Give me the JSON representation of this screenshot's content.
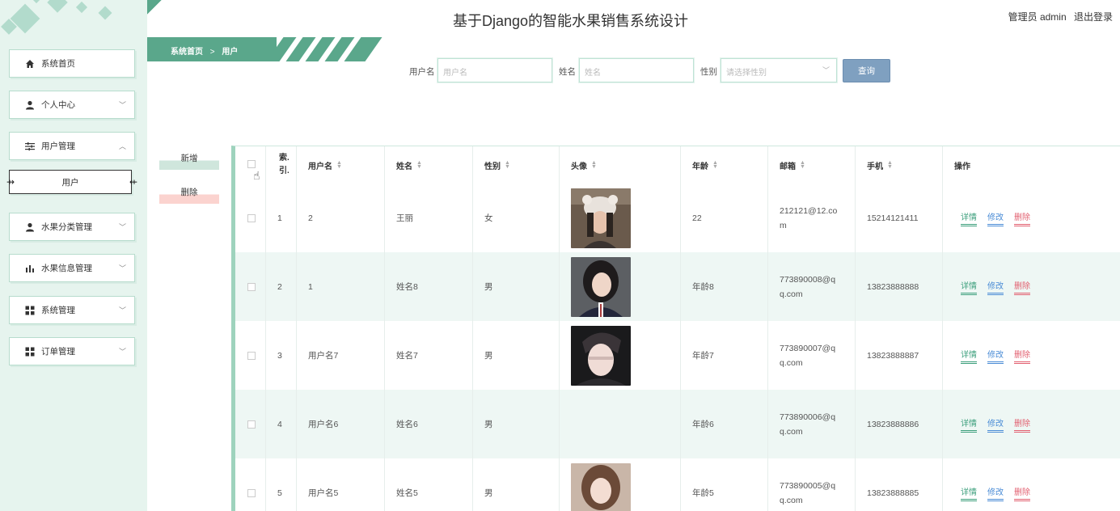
{
  "header": {
    "title": "基于Django的智能水果销售系统设计",
    "user_label": "管理员 admin",
    "logout_label": "退出登录"
  },
  "breadcrumb": {
    "home": "系统首页",
    "separator": ">",
    "current": "用户"
  },
  "sidebar": {
    "items": [
      {
        "label": "系统首页",
        "icon": "home-icon"
      },
      {
        "label": "个人中心",
        "icon": "person-icon"
      },
      {
        "label": "用户管理",
        "icon": "sliders-icon"
      },
      {
        "label": "用户",
        "icon": ""
      },
      {
        "label": "水果分类管理",
        "icon": "person-icon"
      },
      {
        "label": "水果信息管理",
        "icon": "bar-chart-icon"
      },
      {
        "label": "系统管理",
        "icon": "grid-icon"
      },
      {
        "label": "订单管理",
        "icon": "grid-icon"
      }
    ]
  },
  "search": {
    "username_label": "用户名",
    "username_placeholder": "用户名",
    "name_label": "姓名",
    "name_placeholder": "姓名",
    "gender_label": "性别",
    "gender_placeholder": "请选择性别",
    "button": "查询"
  },
  "actions": {
    "add": "新增",
    "delete": "删除"
  },
  "table": {
    "headers": [
      "索引",
      "用户名",
      "姓名",
      "性别",
      "头像",
      "年龄",
      "邮箱",
      "手机",
      "操作"
    ],
    "index_header_line1": "索.",
    "index_header_line2": "引.",
    "ops": {
      "detail": "详情",
      "edit": "修改",
      "remove": "删除"
    },
    "rows": [
      {
        "index": "1",
        "username": "2",
        "name": "王丽",
        "gender": "女",
        "age": "22",
        "email_1": "212121@12.co",
        "email_2": "m",
        "phone": "15214121411",
        "avatar": true
      },
      {
        "index": "2",
        "username": "1",
        "name": "姓名8",
        "gender": "男",
        "age": "年龄8",
        "email_1": "773890008@q",
        "email_2": "q.com",
        "phone": "13823888888",
        "avatar": true
      },
      {
        "index": "3",
        "username": "用户名7",
        "name": "姓名7",
        "gender": "男",
        "age": "年龄7",
        "email_1": "773890007@q",
        "email_2": "q.com",
        "phone": "13823888887",
        "avatar": true
      },
      {
        "index": "4",
        "username": "用户名6",
        "name": "姓名6",
        "gender": "男",
        "age": "年龄6",
        "email_1": "773890006@q",
        "email_2": "q.com",
        "phone": "13823888886",
        "avatar": false
      },
      {
        "index": "5",
        "username": "用户名5",
        "name": "姓名5",
        "gender": "男",
        "age": "年龄5",
        "email_1": "773890005@q",
        "email_2": "q.com",
        "phone": "13823888885",
        "avatar": true
      }
    ]
  },
  "colors": {
    "accent": "#5aa78b",
    "sidebar_bg": "#e6f4ee",
    "search_button": "#7fa0c0",
    "detail": "#3c9f7c",
    "edit": "#4a8cd6",
    "remove": "#e26070"
  }
}
